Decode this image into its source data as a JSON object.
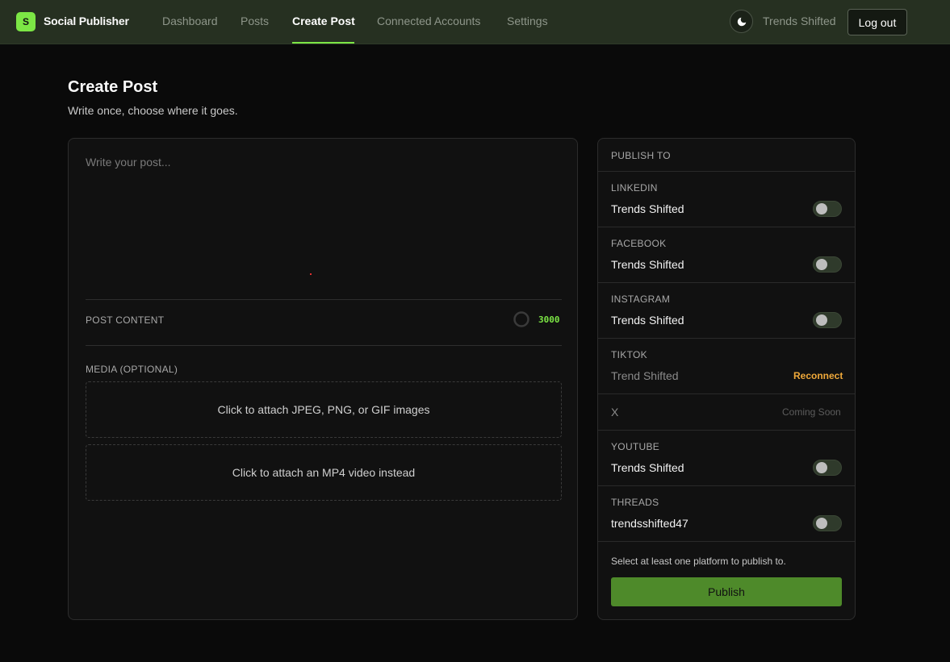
{
  "app": {
    "logo_letter": "S",
    "brand": "Social Publisher"
  },
  "nav": {
    "items": [
      {
        "label": "Dashboard"
      },
      {
        "label": "Posts"
      },
      {
        "label": "Create Post"
      },
      {
        "label": "Connected Accounts"
      },
      {
        "label": "Settings"
      }
    ],
    "active": "Create Post",
    "theme_icon": "moon-icon",
    "user_name": "Trends Shifted",
    "logout_label": "Log out"
  },
  "page": {
    "title": "Create Post",
    "subtitle": "Write once, choose where it goes."
  },
  "editor": {
    "placeholder": "Write your post...",
    "value": "",
    "content_label": "POST CONTENT",
    "char_remaining": "3000",
    "media_label": "MEDIA (OPTIONAL)",
    "image_drop_label": "Click to attach JPEG, PNG, or GIF images",
    "video_drop_label": "Click to attach an MP4 video instead"
  },
  "publish": {
    "header": "PUBLISH TO",
    "platforms": [
      {
        "name": "LINKEDIN",
        "account": "Trends Shifted",
        "state": "toggle",
        "enabled": false
      },
      {
        "name": "FACEBOOK",
        "account": "Trends Shifted",
        "state": "toggle",
        "enabled": false
      },
      {
        "name": "INSTAGRAM",
        "account": "Trends Shifted",
        "state": "toggle",
        "enabled": false
      },
      {
        "name": "TIKTOK",
        "account": "Trend Shifted",
        "state": "reconnect",
        "action_label": "Reconnect"
      },
      {
        "name": "X",
        "state": "coming_soon",
        "status_label": "Coming Soon"
      },
      {
        "name": "YOUTUBE",
        "account": "Trends Shifted",
        "state": "toggle",
        "enabled": false
      },
      {
        "name": "THREADS",
        "account": "trendsshifted47",
        "state": "toggle",
        "enabled": false
      }
    ],
    "helper_text": "Select at least one platform to publish to.",
    "publish_label": "Publish"
  },
  "colors": {
    "accent": "#7ce645",
    "topbar_bg": "#263021",
    "page_bg": "#0a0a0a",
    "card_bg": "#111111",
    "publish_button": "#4e8a2a",
    "reconnect": "#f0a93a"
  }
}
